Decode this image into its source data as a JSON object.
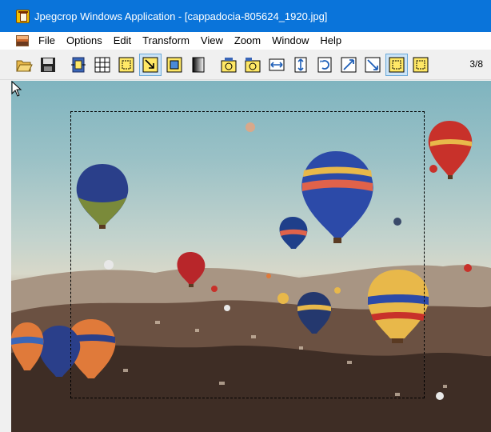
{
  "window": {
    "title": "Jpegcrop Windows Application - [cappadocia-805624_1920.jpg]"
  },
  "menu": {
    "items": [
      "File",
      "Options",
      "Edit",
      "Transform",
      "View",
      "Zoom",
      "Window",
      "Help"
    ]
  },
  "toolbar": {
    "buttons": [
      {
        "icon": "open-folder-icon"
      },
      {
        "icon": "save-disk-icon"
      },
      {
        "icon": "copy-icon"
      },
      {
        "icon": "grid-icon"
      },
      {
        "icon": "select-icon"
      },
      {
        "icon": "crop-arrow-icon",
        "active": true
      },
      {
        "icon": "fit-icon"
      },
      {
        "icon": "grayscale-icon"
      },
      {
        "icon": "rotate-ccw-icon"
      },
      {
        "icon": "rotate-cw-icon"
      },
      {
        "icon": "flip-horizontal-icon"
      },
      {
        "icon": "flip-vertical-icon"
      },
      {
        "icon": "rotate-arrow-icon"
      },
      {
        "icon": "transpose-icon"
      },
      {
        "icon": "transverse-icon"
      },
      {
        "icon": "crop-selection-icon",
        "active": true
      },
      {
        "icon": "crop-rect-icon"
      }
    ],
    "page_counter": "3/8"
  },
  "colors": {
    "titlebar": "#0a74da",
    "toolbar_active": "#cce4f7"
  }
}
